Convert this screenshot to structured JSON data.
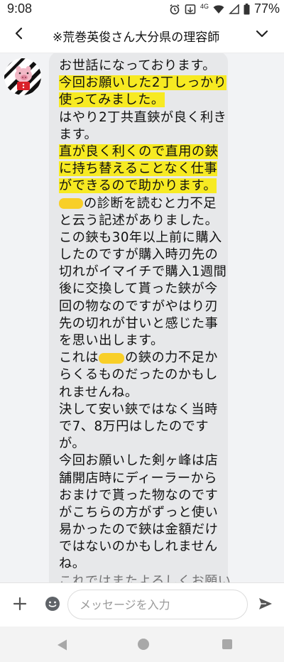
{
  "status_bar": {
    "time": "9:08",
    "network": "4G",
    "battery": "77%"
  },
  "header": {
    "title": "※荒巻英俊さん大分県の理容師"
  },
  "message": {
    "lines": [
      {
        "text": "お世話になっております。",
        "highlight": false
      },
      {
        "text": "今回お願いした2丁しっかり",
        "highlight": true
      },
      {
        "text": "使ってみました。",
        "highlight": true
      },
      {
        "text": "はやり2丁共直鋏が良く利き",
        "highlight": false
      },
      {
        "text": "ます。",
        "highlight": false
      },
      {
        "text": "直が良く利くので直用の鋏",
        "highlight": true
      },
      {
        "text": "に持ち替えることなく仕事",
        "highlight": true
      },
      {
        "text": "ができるので助かります。",
        "highlight": true
      },
      {
        "text": "の診断を読むと力不足",
        "highlight": false
      },
      {
        "text": "と云う記述がありました。",
        "highlight": false
      },
      {
        "text": "この鋏も30年以上前に購入",
        "highlight": false
      },
      {
        "text": "したのですが購入時刃先の",
        "highlight": false
      },
      {
        "text": "切れがイマイチで購入1週間",
        "highlight": false
      },
      {
        "text": "後に交換して貰った鋏が今",
        "highlight": false
      },
      {
        "text": "回の物なのですがやはり刃",
        "highlight": false
      },
      {
        "text": "先の切れが甘いと感じた事",
        "highlight": false
      },
      {
        "text": "を思い出します。",
        "highlight": false
      },
      {
        "text_before": "これは",
        "text_after": "の鋏の力不足か",
        "highlight": false
      },
      {
        "text": "らくるものだったのかもし",
        "highlight": false
      },
      {
        "text": "れませんね。",
        "highlight": false
      },
      {
        "text": "決して安い鋏ではなく当時",
        "highlight": false
      },
      {
        "text": "で7、8万円はしたのです",
        "highlight": false
      },
      {
        "text": "が。",
        "highlight": false
      },
      {
        "text": "今回お願いした剣ヶ峰は店",
        "highlight": false
      },
      {
        "text": "舗開店時にディーラーから",
        "highlight": false
      },
      {
        "text": "おまけで貰った物なのです",
        "highlight": false
      },
      {
        "text": "がこちらの方がずっと使い",
        "highlight": false
      },
      {
        "text": "易かったので鋏は金額だけ",
        "highlight": false
      },
      {
        "text": "ではないのかもしれません",
        "highlight": false
      },
      {
        "text": "ね。",
        "highlight": false
      },
      {
        "text": "これではまたよろしくお願い",
        "highlight": false
      }
    ]
  },
  "input_bar": {
    "placeholder": "メッセージを入力"
  },
  "colors": {
    "highlight": "#f7ea22",
    "redaction": "#f8cf28",
    "bubble": "#e7e8ea",
    "chat_background": "#f2f3f5"
  },
  "icons": [
    "back-arrow-icon",
    "chevron-down-icon",
    "plus-icon",
    "emoji-icon",
    "send-icon",
    "alarm-icon",
    "wifi-icon",
    "signal-icon",
    "battery-icon"
  ]
}
